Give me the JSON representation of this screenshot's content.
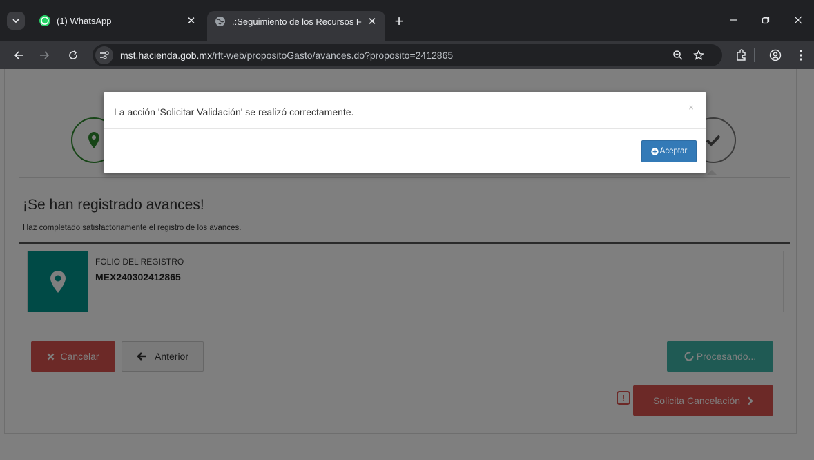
{
  "browser": {
    "tabs": [
      {
        "title": "(1) WhatsApp",
        "favicon": "whatsapp-icon",
        "active": false
      },
      {
        "title": ".:Seguimiento de los Recursos F",
        "favicon": "globe-icon",
        "active": true
      }
    ],
    "new_tab": "+",
    "url_host": "mst.hacienda.gob.mx",
    "url_path": "/rft-web/propositoGasto/avances.do?proposito=2412865"
  },
  "page": {
    "title": "¡Se han registrado avances!",
    "subtitle": "Haz completado satisfactoriamente el registro de los avances.",
    "folio_label": "FOLIO DEL REGISTRO",
    "folio_value": "MEX240302412865",
    "buttons": {
      "cancel": "Cancelar",
      "previous": "Anterior",
      "processing": "Procesando...",
      "request_cancel": "Solicita Cancelación"
    }
  },
  "modal": {
    "message": "La acción 'Solicitar Validación' se realizó correctamente.",
    "close": "×",
    "accept": "Aceptar"
  },
  "colors": {
    "teal": "#00958c",
    "danger": "#d9534f",
    "primary": "#337ab7",
    "chrome_dark": "#202124"
  }
}
